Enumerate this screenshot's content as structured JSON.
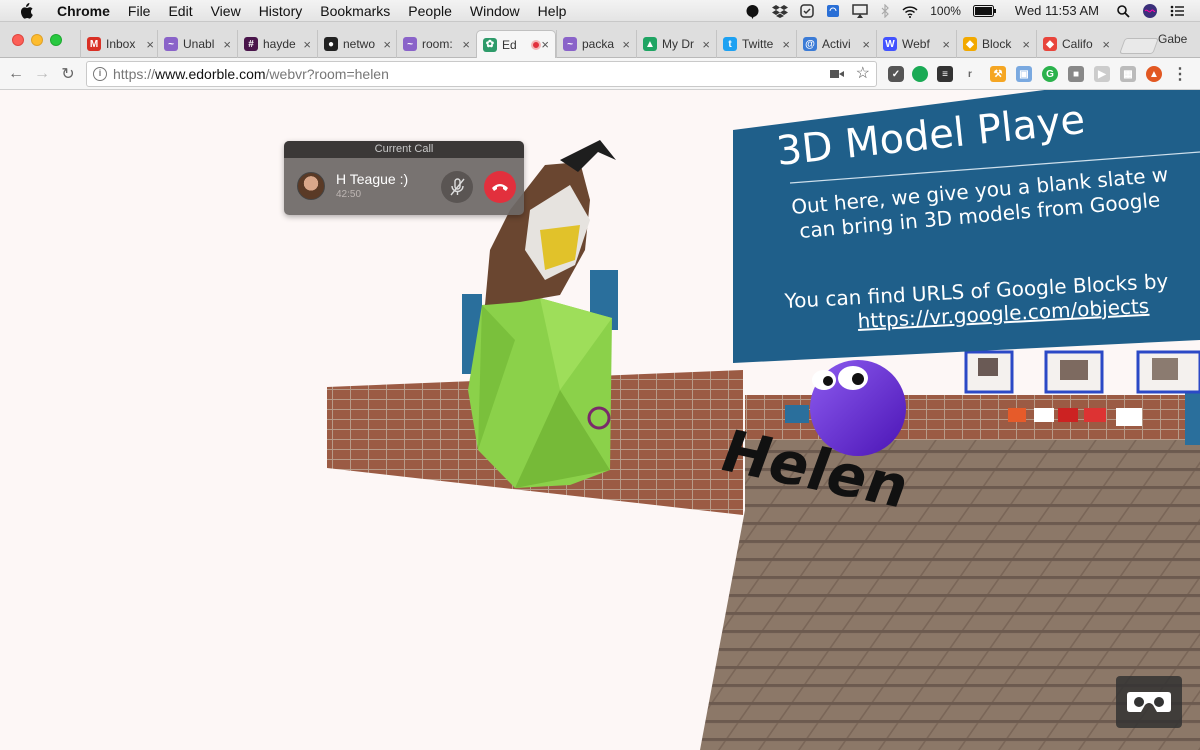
{
  "menubar": {
    "app_name": "Chrome",
    "items": [
      "File",
      "Edit",
      "View",
      "History",
      "Bookmarks",
      "People",
      "Window",
      "Help"
    ],
    "battery": "100%",
    "clock": "Wed 11:53 AM"
  },
  "tabs": [
    {
      "label": "Inbox",
      "icon": "gmail-icon",
      "color": "#d93025",
      "glyph": "M"
    },
    {
      "label": "Unabl",
      "icon": "sparkle-icon",
      "color": "#8a63c9",
      "glyph": "~"
    },
    {
      "label": "hayde",
      "icon": "slack-icon",
      "color": "#4a154b",
      "glyph": "#"
    },
    {
      "label": "netwo",
      "icon": "github-icon",
      "color": "#222",
      "glyph": "●"
    },
    {
      "label": "room:",
      "icon": "sparkle-icon",
      "color": "#8a63c9",
      "glyph": "~"
    },
    {
      "label": "Ed",
      "icon": "edorble-icon",
      "color": "#2e9b6a",
      "glyph": "✿",
      "active": true
    },
    {
      "label": "packa",
      "icon": "sparkle-icon",
      "color": "#8a63c9",
      "glyph": "~"
    },
    {
      "label": "My Dr",
      "icon": "drive-icon",
      "color": "#1fa463",
      "glyph": "▲"
    },
    {
      "label": "Twitte",
      "icon": "twitter-icon",
      "color": "#1da1f2",
      "glyph": "t"
    },
    {
      "label": "Activi",
      "icon": "activity-icon",
      "color": "#3b7bd6",
      "glyph": "@"
    },
    {
      "label": "Webf",
      "icon": "webflow-icon",
      "color": "#4353ff",
      "glyph": "W"
    },
    {
      "label": "Block",
      "icon": "blocks-icon",
      "color": "#f2a900",
      "glyph": "◆"
    },
    {
      "label": "Califo",
      "icon": "chrome-store-icon",
      "color": "#e8453c",
      "glyph": "◆"
    }
  ],
  "profile_name": "Gabe",
  "address": {
    "prefix": "https://",
    "host": "www.edorble.com",
    "path": "/webvr?room=helen"
  },
  "scene": {
    "sign_title": "3D Model Playe",
    "sign_line1": "Out here, we give you a blank slate w",
    "sign_line2": "can bring in 3D models from Google",
    "sign_line3": "You can find URLS of Google Blocks by",
    "sign_line4": "https://vr.google.com/objects",
    "avatar_name": "Helen"
  },
  "call": {
    "header": "Current Call",
    "name": "H Teague :)",
    "duration": "42:50"
  },
  "colors": {
    "sign_blue": "#1f5f8a",
    "brick": "#9a5c45",
    "floor_wood": "#8a7466",
    "avatar_purple": "#6f2ed6",
    "model_green": "#8bd14a",
    "end_call_red": "#e2303d"
  }
}
